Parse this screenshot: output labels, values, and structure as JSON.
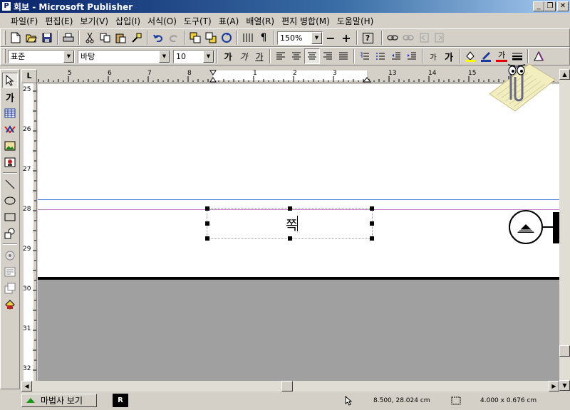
{
  "window": {
    "title": "회보 - Microsoft Publisher",
    "app_icon_letter": "P",
    "minimize": "_",
    "restore": "❐",
    "close": "✕"
  },
  "menu": [
    {
      "label": "파일(F)"
    },
    {
      "label": "편집(E)"
    },
    {
      "label": "보기(V)"
    },
    {
      "label": "삽입(I)"
    },
    {
      "label": "서식(O)"
    },
    {
      "label": "도구(T)"
    },
    {
      "label": "표(A)"
    },
    {
      "label": "배열(R)"
    },
    {
      "label": "편지 병합(M)"
    },
    {
      "label": "도움말(H)"
    }
  ],
  "standard_toolbar": {
    "zoom": "150%",
    "zoom_out": "−",
    "zoom_in": "+",
    "help": "?"
  },
  "format_toolbar": {
    "style": "표준",
    "font": "바탕",
    "size": "10",
    "grow_font": "가",
    "shrink_font": "가",
    "bold_sample": "가",
    "italic_sample": "가",
    "underline_sample": "가",
    "font_color_sample": "가"
  },
  "tool_palette": {
    "text_tool": "가"
  },
  "ruler": {
    "corner": "L",
    "horizontal_labels": [
      "5",
      "6",
      "7",
      "8",
      "1",
      "2",
      "3",
      "13",
      "14",
      "15"
    ],
    "vertical_labels": [
      "25",
      "26",
      "27",
      "28",
      "29",
      "30",
      "31",
      "32"
    ]
  },
  "document": {
    "textbox_text": "쪽"
  },
  "statusbar": {
    "wizard_label": "마법사 보기",
    "page_indicator": "R",
    "position": "8.500, 28.024 cm",
    "size": "4.000 x 0.676 cm"
  },
  "colors": {
    "titlebar_start": "#0a246a",
    "titlebar_end": "#a6caf0",
    "chrome": "#d4d0c8",
    "workspace": "#a0a0a0",
    "guide_blue": "#4a7fd8",
    "guide_pink": "#c080c0"
  }
}
